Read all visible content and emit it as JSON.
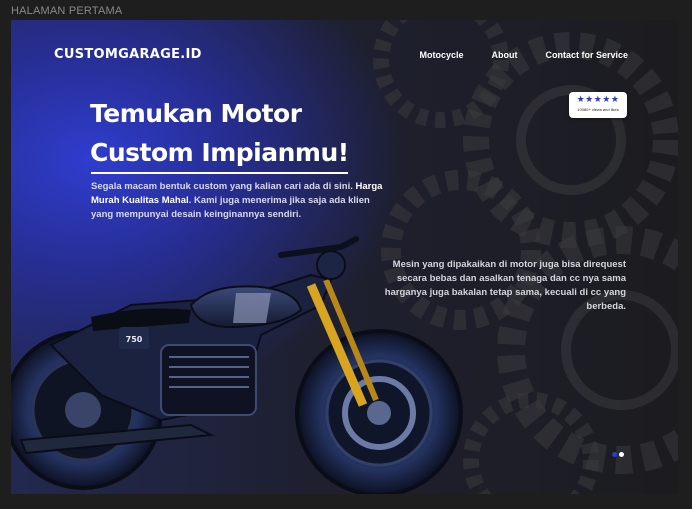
{
  "frame": {
    "label": "HALAMAN PERTAMA"
  },
  "header": {
    "brand": "CUSTOMGARAGE.ID",
    "nav": [
      "Motocycle",
      "About",
      "Contact for Service"
    ]
  },
  "rating_badge": {
    "stars": "★★★★★",
    "rating_value": 5,
    "caption": "10080+ views and likes"
  },
  "hero": {
    "title_line1": "Temukan Motor",
    "title_line2": "Custom Impianmu!",
    "desc_part1": "Segala macam bentuk custom yang kalian cari ada di sini.",
    "desc_bold": "Harga Murah Kualitas Mahal",
    "desc_part2": ". Kami juga menerima jika saja ada klien yang mempunyai desain keinginannya sendiri."
  },
  "side_note": "Mesin yang dipakaikan di motor juga bisa direquest secara bebas dan asalkan tenaga dan cc nya sama harganya juga bakalan tetap sama, kecuali di cc yang berbeda.",
  "motorcycle": {
    "plate_text": "750"
  },
  "carousel": {
    "active_index": 0,
    "total": 2
  },
  "colors": {
    "accent_blue": "#2f3fd6",
    "dot_active": "#2b3bd0",
    "dot_inactive": "#ffffff",
    "fork_gold": "#d9a520"
  }
}
